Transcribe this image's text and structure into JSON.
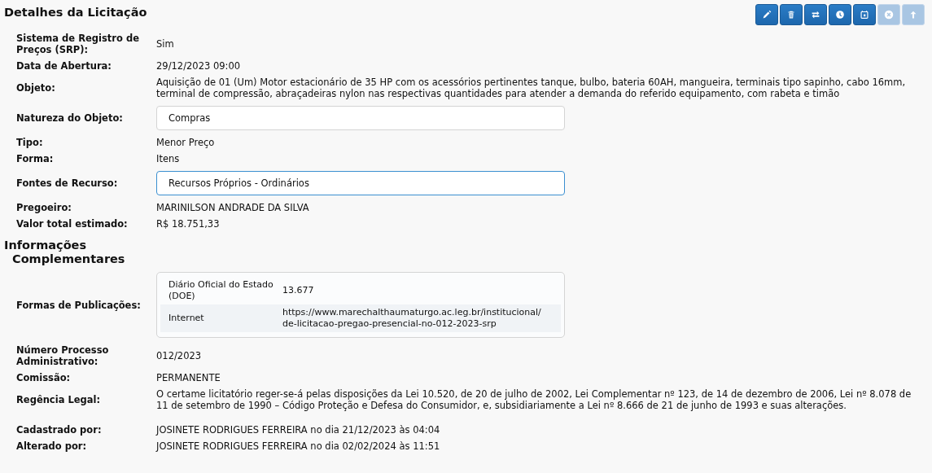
{
  "title": "Detalhes da Licitação",
  "toolbar": [
    {
      "kind": "edit",
      "disabled": false
    },
    {
      "kind": "delete",
      "disabled": false
    },
    {
      "kind": "swap",
      "disabled": false
    },
    {
      "kind": "clock",
      "disabled": false
    },
    {
      "kind": "calendar",
      "disabled": false
    },
    {
      "kind": "cancel",
      "disabled": true
    },
    {
      "kind": "up",
      "disabled": true
    }
  ],
  "details": [
    {
      "kind": "text",
      "label": "Sistema de Registro de Preços (SRP):",
      "value": "Sim"
    },
    {
      "kind": "text",
      "label": "Data de Abertura:",
      "value": "29/12/2023 09:00"
    },
    {
      "kind": "text",
      "label": "Objeto:",
      "value": "Aquisição de 01 (Um) Motor estacionário de 35 HP com os acessórios pertinentes tanque, bulbo, bateria 60AH, mangueira, terminais tipo sapinho, cabo 16mm, terminal de compressão, abraçadeiras nylon nas respectivas quantidades para atender a demanda do referido equipamento, com rabeta e timão"
    },
    {
      "kind": "field",
      "label": "Natureza do Objeto:",
      "value": "Compras",
      "focused": false
    },
    {
      "kind": "text",
      "label": "Tipo:",
      "value": "Menor Preço"
    },
    {
      "kind": "text",
      "label": "Forma:",
      "value": "Itens"
    },
    {
      "kind": "field",
      "label": "Fontes de Recurso:",
      "value": "Recursos Próprios - Ordinários",
      "focused": true
    },
    {
      "kind": "text",
      "label": "Pregoeiro:",
      "value": "MARINILSON ANDRADE DA SILVA"
    },
    {
      "kind": "text",
      "label": "Valor total estimado:",
      "value": "R$ 18.751,33"
    }
  ],
  "section_title": "Informações Complementares",
  "complementary": [
    {
      "kind": "table",
      "label": "Formas de Publicações:",
      "rows": [
        {
          "name": "Diário Oficial do Estado (DOE)",
          "value": "13.677"
        },
        {
          "name": "Internet",
          "value": "https://www.marechalthaumaturgo.ac.leg.br/institucional/\nde-licitacao-pregao-presencial-no-012-2023-srp"
        }
      ]
    },
    {
      "kind": "text",
      "label": "Número Processo Administrativo:",
      "value": "012/2023"
    },
    {
      "kind": "text",
      "label": "Comissão:",
      "value": "PERMANENTE"
    },
    {
      "kind": "text",
      "label": "Regência Legal:",
      "value": "O certame licitatório reger-se-á pelas disposições da Lei 10.520, de 20 de julho de 2002, Lei Complementar nº 123, de 14 de dezembro de 2006, Lei nº 8.078 de 11 de setembro de 1990 – Código Proteção e Defesa do Consumidor, e, subsidiariamente a Lei nº 8.666 de 21 de junho de 1993 e suas alterações."
    },
    {
      "kind": "text",
      "label": "Cadastrado por:",
      "value": "JOSINETE RODRIGUES FERREIRA no dia 21/12/2023 às 04:04"
    },
    {
      "kind": "text",
      "label": "Alterado por:",
      "value": "JOSINETE RODRIGUES FERREIRA no dia 02/02/2024 às 11:51"
    }
  ]
}
